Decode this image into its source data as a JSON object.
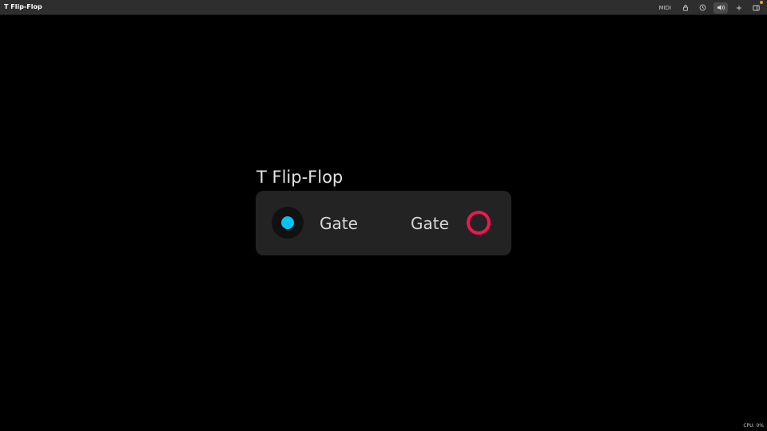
{
  "app": {
    "title": "T Flip-Flop"
  },
  "toolbar": {
    "midi_label": "MIDI",
    "icons": [
      "lock-icon",
      "clock-icon",
      "speaker-icon",
      "plus-icon",
      "panel-icon"
    ],
    "notification_color": "#f0a020"
  },
  "module": {
    "title": "T Flip-Flop",
    "input": {
      "label": "Gate",
      "color": "#00c3f5"
    },
    "output": {
      "label": "Gate",
      "color": "#f01650"
    }
  },
  "status": {
    "cpu": "CPU: 0%"
  }
}
